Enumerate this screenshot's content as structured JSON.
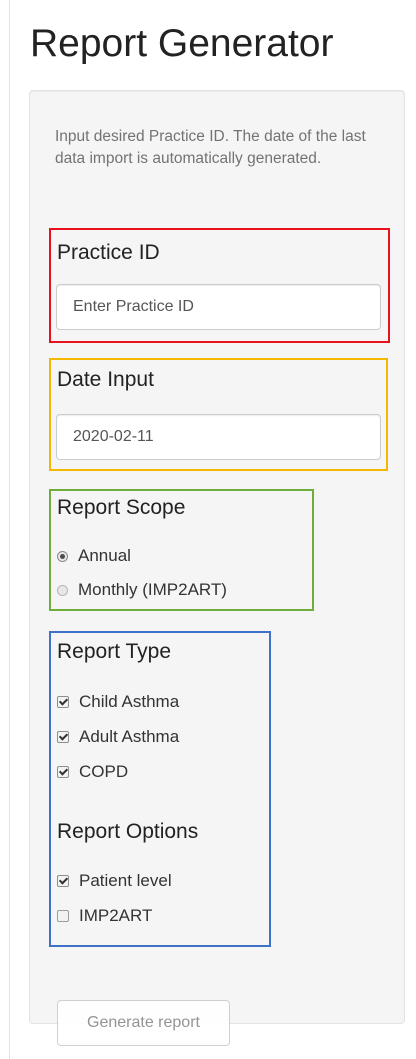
{
  "app": {
    "title": "Report Generator"
  },
  "sidebar": {
    "help_text": "Input desired Practice ID. The date of the last data import is automatically generated.",
    "practice_id": {
      "label": "Practice ID",
      "placeholder": "Enter Practice ID",
      "value": ""
    },
    "date_input": {
      "label": "Date Input",
      "value": "2020-02-11"
    },
    "report_scope": {
      "label": "Report Scope",
      "options": [
        {
          "label": "Annual",
          "selected": true
        },
        {
          "label": "Monthly (IMP2ART)",
          "selected": false
        }
      ]
    },
    "report_type": {
      "label": "Report Type",
      "options": [
        {
          "label": "Child Asthma",
          "checked": true
        },
        {
          "label": "Adult Asthma",
          "checked": true
        },
        {
          "label": "COPD",
          "checked": true
        }
      ]
    },
    "report_options": {
      "label": "Report Options",
      "options": [
        {
          "label": "Patient level",
          "checked": true
        },
        {
          "label": "IMP2ART",
          "checked": false
        }
      ]
    },
    "generate_button": {
      "label": "Generate report",
      "disabled": true
    }
  },
  "colors": {
    "practice_id_box": "#e8121c",
    "date_input_box": "#f5b800",
    "report_scope_box": "#6fae3b",
    "report_type_box": "#3d72c7",
    "well_background": "#f5f5f5"
  }
}
